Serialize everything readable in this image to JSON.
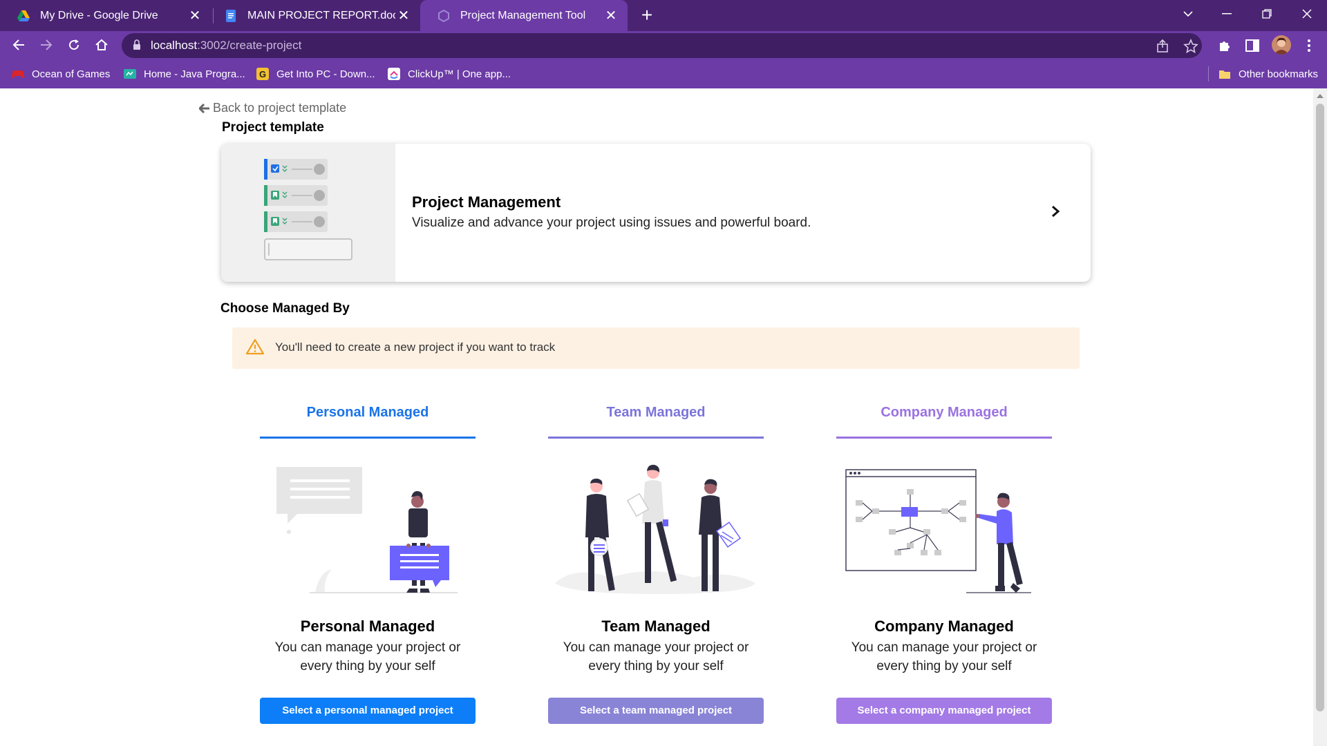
{
  "browser": {
    "tabs": [
      {
        "title": "My Drive - Google Drive"
      },
      {
        "title": "MAIN PROJECT REPORT.docx - G"
      },
      {
        "title": "Project Management Tool"
      }
    ],
    "url_host": "localhost",
    "url_path": ":3002/create-project",
    "bookmarks": [
      {
        "label": "Ocean of Games"
      },
      {
        "label": "Home - Java Progra..."
      },
      {
        "label": "Get Into PC - Down..."
      },
      {
        "label": "ClickUp™ | One app..."
      }
    ],
    "other_bookmarks": "Other bookmarks"
  },
  "page": {
    "back_link": "Back to project template",
    "template_heading": "Project template",
    "template": {
      "name": "Project Management",
      "description": "Visualize and advance your project using issues and powerful board."
    },
    "managed_heading": "Choose Managed By",
    "alert": "You'll need to create a new project if you want to track",
    "options": [
      {
        "tab": "Personal Managed",
        "title": "Personal Managed",
        "desc_line1": "You can manage your project or",
        "desc_line2": "every thing by your self",
        "button": "Select a personal managed project",
        "color": "#1a73e8",
        "button_color": "#0d7ef8"
      },
      {
        "tab": "Team Managed",
        "title": "Team Managed",
        "desc_line1": "You can manage your project or",
        "desc_line2": "every thing by your self",
        "button": "Select a team managed project",
        "color": "#7b74d9",
        "button_color": "#8984d6"
      },
      {
        "tab": "Company Managed",
        "title": "Company Managed",
        "desc_line1": "You can manage your project or",
        "desc_line2": "every thing by your self",
        "button": "Select a company managed project",
        "color": "#9a72e0",
        "button_color": "#a37ae6"
      }
    ]
  }
}
